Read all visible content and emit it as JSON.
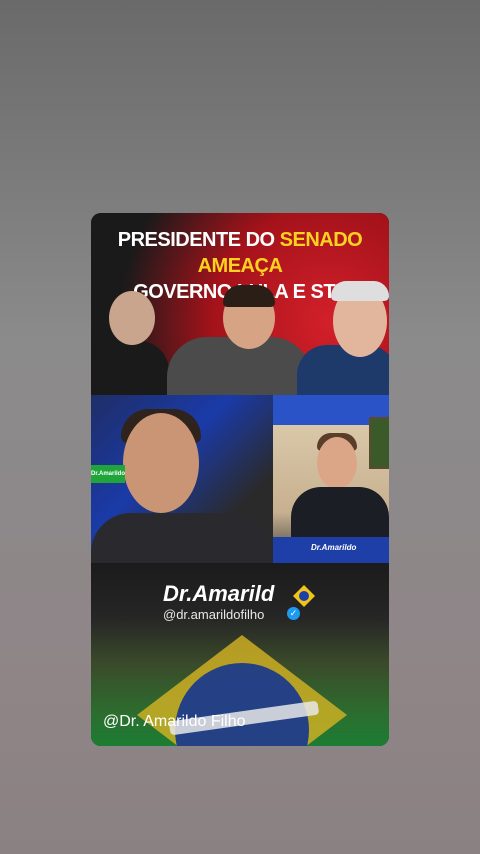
{
  "video": {
    "headline_part1": "PRESIDENTE DO ",
    "headline_highlight": "SENADO AMEAÇA",
    "headline_line2": "GOVERNO LULA E STF",
    "small_tag": "Dr.Amarildo",
    "inset_logo": "Dr.Amarildo"
  },
  "brand": {
    "name": "Dr.Amarild",
    "handle": "@dr.amarildofilho",
    "verified_glyph": "✓",
    "footer_handle": "@Dr. Amarildo Filho",
    "accent": "#ffd21f"
  }
}
